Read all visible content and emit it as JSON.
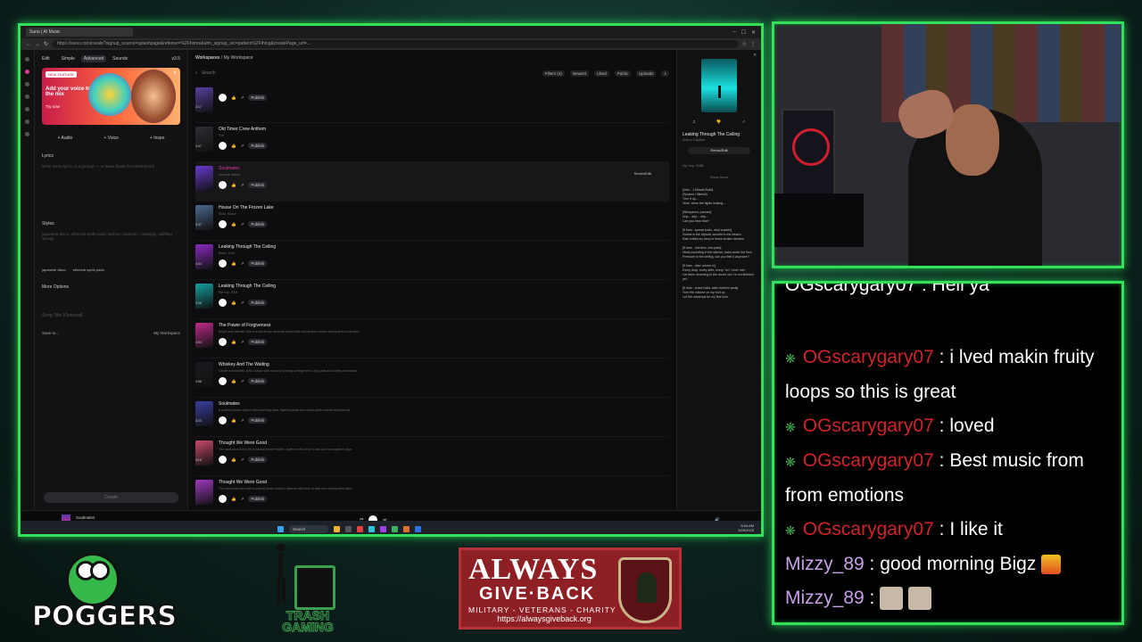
{
  "browser": {
    "tab_title": "Suno | AI Music",
    "url": "https://suno.com/create?signup_source=splashpage&referrer=%2Fhome&utm_signup_src=pattern%2Fthing&createPage_url=..."
  },
  "sidebar_create": {
    "title": "Edit",
    "modes": [
      "Simple",
      "Advanced",
      "Sounds"
    ],
    "version": "v3.5",
    "promo": {
      "badge": "NEW FEATURE",
      "text": "Add your voice to the mix",
      "cta": "Try now"
    },
    "add_buttons": [
      "+ Audio",
      "+ Voice",
      "+ Inspo"
    ],
    "lyrics_label": "Lyrics",
    "lyrics_placeholder": "Write some lyrics or a prompt — or leave blank for instrumental",
    "styles_label": "Styles",
    "styles_placeholder": "japanese disco, ethereal synth pads, techno, euphoric, nostalgic, uplifting strings",
    "style_chips": [
      "japanese disco",
      "ethereal synth pads"
    ],
    "more_options": "More Options",
    "song_title_placeholder": "Song Title (Optional)",
    "save_to": "Save to...",
    "save_target": "My Workspace",
    "create_button": "Create"
  },
  "workspace": {
    "breadcrumb_root": "Workspaces",
    "breadcrumb_current": "My Workspace",
    "search_placeholder": "Search",
    "filters": [
      "Filters (3)",
      "Newest",
      "Liked",
      "Public",
      "Uploads"
    ],
    "page": "1",
    "publish_label": "Publish",
    "remix_label": "Remix/Edit",
    "songs": [
      {
        "title": "",
        "desc": "",
        "dur": "2:17",
        "color": "#5840a0"
      },
      {
        "title": "Old Timer Crew Anthem",
        "desc": "Fun",
        "dur": "3:47",
        "color": "#2e2e34"
      },
      {
        "title": "Soulmates",
        "desc": "Acoustic Ballad",
        "dur": "",
        "color": "#6a3ad0",
        "active": true
      },
      {
        "title": "House On The Frozen Lake",
        "desc": "EDM, House",
        "dur": "3:47",
        "color": "#4a6a90"
      },
      {
        "title": "Leaking Through The Ceiling",
        "desc": "Blues, Soul",
        "dur": "4:44",
        "color": "#8a2ac0"
      },
      {
        "title": "Leaking Through The Ceiling",
        "desc": "Hip hop, R&B",
        "dur": "3:26",
        "color": "#14a0a0"
      },
      {
        "title": "The Power of Forgiveness",
        "desc": "Bright and intimate, this is a mid-tempo acoustic ballad with soft spoken verses and sparse production",
        "dur": "4:04",
        "color": "#c02a8a"
      },
      {
        "title": "Whiskey And The Waiting",
        "desc": "Gentle melancholic piano ballad with a slowly building arrangement, airy pads and subtle percussion",
        "dur": "3:56",
        "color": "#1a1a1f"
      },
      {
        "title": "Soulmates",
        "desc": "A pulsing house rhythm with bouncing bass, layered guitar and warm synth chords rising slowly",
        "dur": "3:23",
        "color": "#3a40a0"
      },
      {
        "title": "Thought We Were Good",
        "desc": "The track launches with a pulsing house rhythm, layered with crisp hi-hats and syncopated claps",
        "dur": "3:16",
        "color": "#c84a6a"
      },
      {
        "title": "Thought We Were Good",
        "desc": "The track launches with a pulsing house rhythm, layered with crisp hi-hats and syncopated claps",
        "dur": "",
        "color": "#a03ac0"
      }
    ]
  },
  "detail": {
    "likes": "2",
    "title": "Leaking Through The Ceiling",
    "caption": "Add a Caption",
    "remix": "Remix/Edit",
    "tags": "hip hop, R&B",
    "show_more": "Show More",
    "lyrics": "[Intro - 1 Minute Build]\n(Spoken / filtered)\nTurn it up...\nYeah, leave the lights leaking...\n\n[Whispered, panned]\nDrip... drip... drip...\nCan you hear that?\n\n[8 bars - sparse pads, vinyl crackle]\nVoices in the drywall, secrets in the beams\nRain writes my story in these broken dreams\n\n[8 bars - hat ticks, low-pass]\nHead pounding in the silence, bass under the floor\nPressure in the ceiling, can you feel it anymore?\n\n[8 bars - riser comes in]\nEvery drop, every debt, every \"no\" I ever met\nI've been drowning in the doubt, but I'm not finished yet\n\n[8 bars - snare build, side-chained pads]\nTurn the volume on my hurt up\nLet the raindrops be my first love"
  },
  "player": {
    "title": "Soulmates",
    "subtitle": "bigz/bigzstugs",
    "elapsed": "0:55",
    "total": "3:52",
    "progress": 0.35
  },
  "taskbar": {
    "search": "Search",
    "time": "8:54 AM",
    "date": "5/28/2025"
  },
  "chat": {
    "cutoff": "OGscarygary07 : Hell ya",
    "messages": [
      {
        "user": "OGscarygary07",
        "text": "i lved makin fruity loops so this is great",
        "badge": true
      },
      {
        "user": "OGscarygary07",
        "text": "loved",
        "badge": true
      },
      {
        "user": "OGscarygary07",
        "text": "Best music from from emotions",
        "badge": true
      },
      {
        "user": "OGscarygary07",
        "text": "I like it",
        "badge": true
      },
      {
        "user": "Mizzy_89",
        "text": "good morning Bigz",
        "badge": false
      },
      {
        "user": "Mizzy_89",
        "text": "",
        "badge": false
      }
    ]
  },
  "logos": {
    "poggers": "POGGERS",
    "trash": "TRASH GAMING",
    "agb": {
      "line1": "ALWAYS",
      "line2": "GIVE·BACK",
      "line3": "MILITARY - VETERANS - CHARITY",
      "url": "https://alwaysgiveback.org"
    }
  },
  "colors": {
    "frame": "#33e05a",
    "accent": "#e0389a",
    "chat_user": "#d0242a",
    "chat_user2": "#c7a0e8"
  }
}
